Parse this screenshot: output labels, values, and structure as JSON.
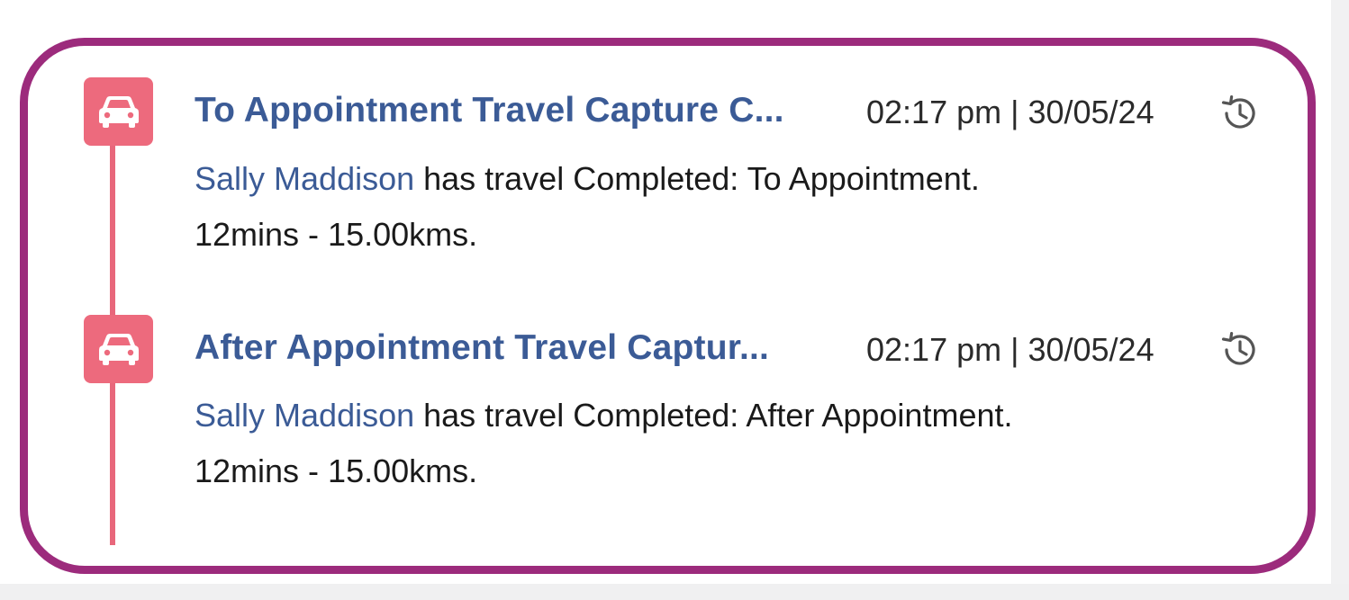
{
  "timeline": {
    "entries": [
      {
        "title": "To Appointment Travel Capture C...",
        "timestamp": "02:17 pm | 30/05/24",
        "actor": "Sally Maddison",
        "action": " has travel Completed: To Appointment.",
        "details": "12mins - 15.00kms.",
        "icon": "car-icon"
      },
      {
        "title": "After Appointment Travel Captur...",
        "timestamp": "02:17 pm | 30/05/24",
        "actor": "Sally Maddison",
        "action": " has travel Completed: After Appointment.",
        "details": "12mins - 15.00kms.",
        "icon": "car-icon"
      }
    ]
  },
  "colors": {
    "frame_border": "#9c2b7c",
    "icon_background": "#ed6a7d",
    "timeline_line": "#e8677b",
    "title_link": "#3b5b96"
  }
}
